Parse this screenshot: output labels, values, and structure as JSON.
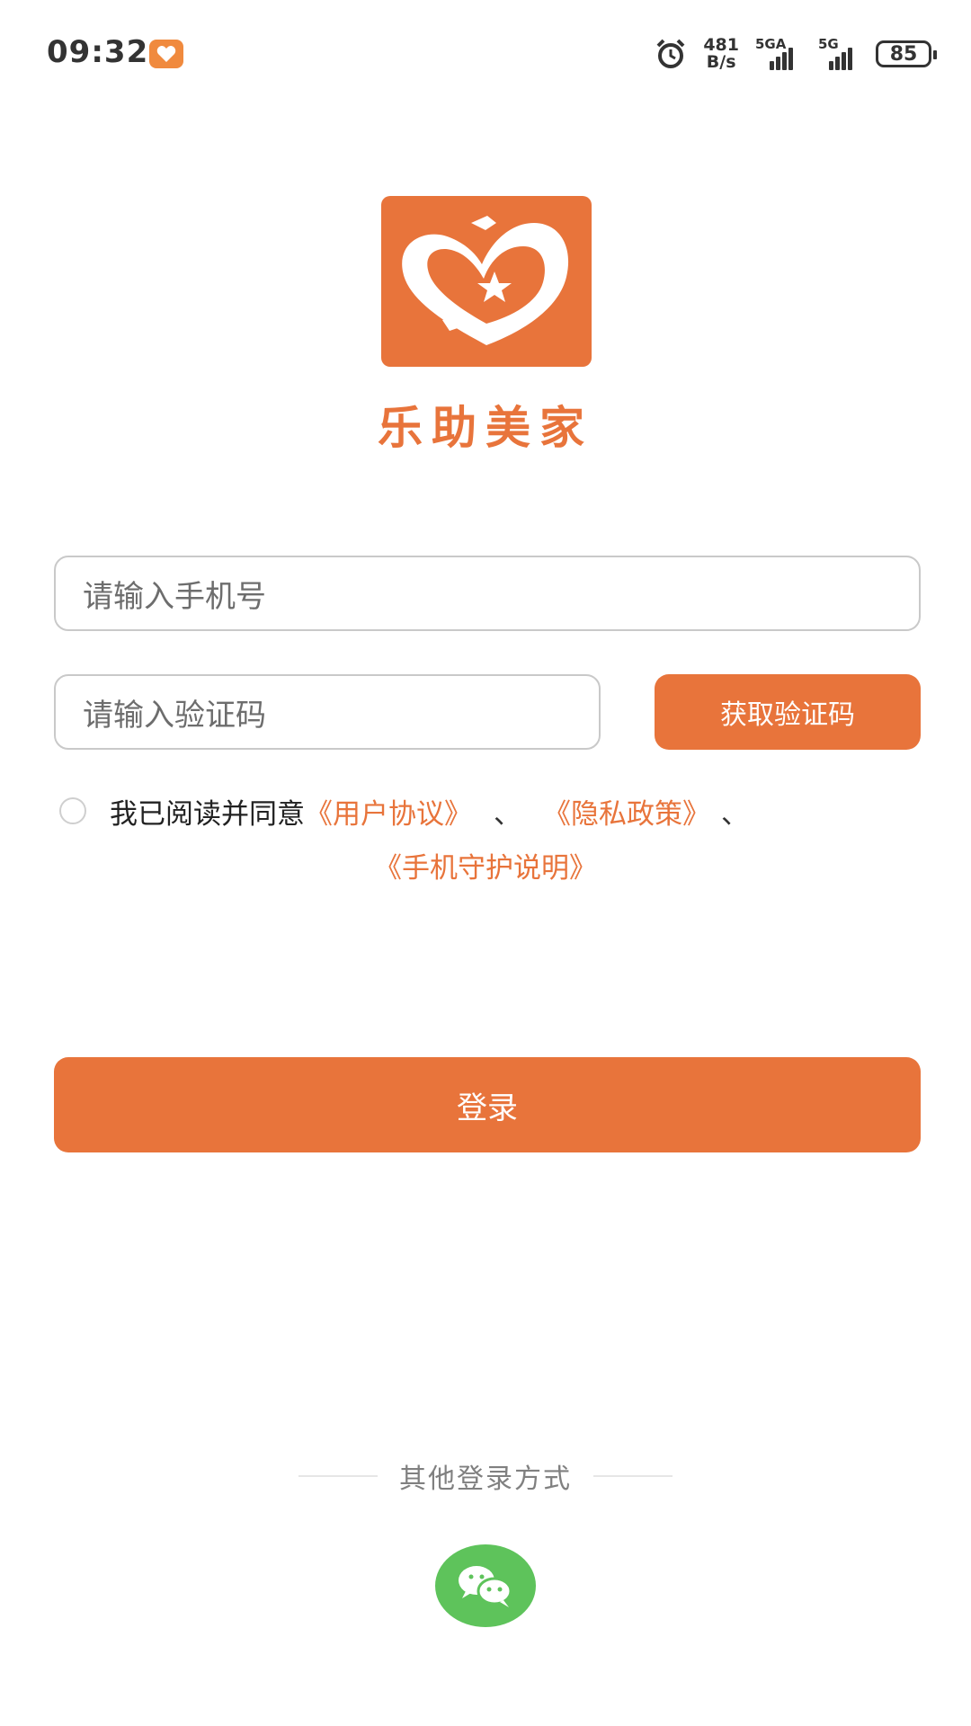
{
  "status_bar": {
    "time": "09:32",
    "net_speed_value": "481",
    "net_speed_unit": "B/s",
    "sim1_label": "5GA",
    "sim2_label": "5G",
    "battery": "85"
  },
  "brand": {
    "name": "乐助美家",
    "color": "#e8743b"
  },
  "form": {
    "phone_placeholder": "请输入手机号",
    "code_placeholder": "请输入验证码",
    "get_code_label": "获取验证码"
  },
  "agreement": {
    "prefix": "我已阅读并同意",
    "user_agreement": "《用户协议》",
    "separator1": "、",
    "privacy_policy": "《隐私政策》",
    "separator2": "、",
    "phone_guard": "《手机守护说明》"
  },
  "login_label": "登录",
  "other_login": {
    "label": "其他登录方式",
    "options": [
      "wechat-icon"
    ]
  }
}
